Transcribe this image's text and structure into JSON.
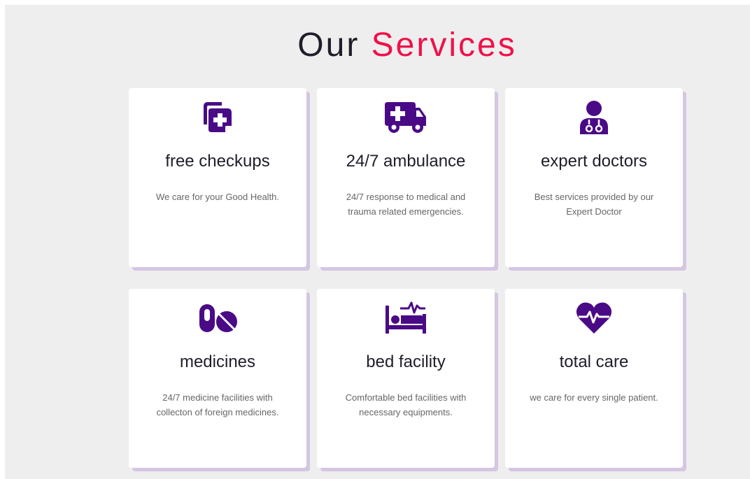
{
  "heading": {
    "part1": "Our",
    "part2": "Services"
  },
  "colors": {
    "icon": "#4a0a86",
    "accent": "#f0104a",
    "shadow": "#d5c6e2"
  },
  "services": [
    {
      "icon": "medical-folder-icon",
      "title": "free checkups",
      "description": "We care for your Good Health."
    },
    {
      "icon": "ambulance-icon",
      "title": "24/7 ambulance",
      "description": "24/7 response to medical and trauma related emergencies."
    },
    {
      "icon": "doctor-icon",
      "title": "expert doctors",
      "description": "Best services provided by our Expert Doctor"
    },
    {
      "icon": "pills-icon",
      "title": "medicines",
      "description": "24/7 medicine facilities with collecton of foreign medicines."
    },
    {
      "icon": "hospital-bed-icon",
      "title": "bed facility",
      "description": "Comfortable bed facilities with necessary equipments."
    },
    {
      "icon": "heartbeat-icon",
      "title": "total care",
      "description": "we care for every single patient."
    }
  ]
}
